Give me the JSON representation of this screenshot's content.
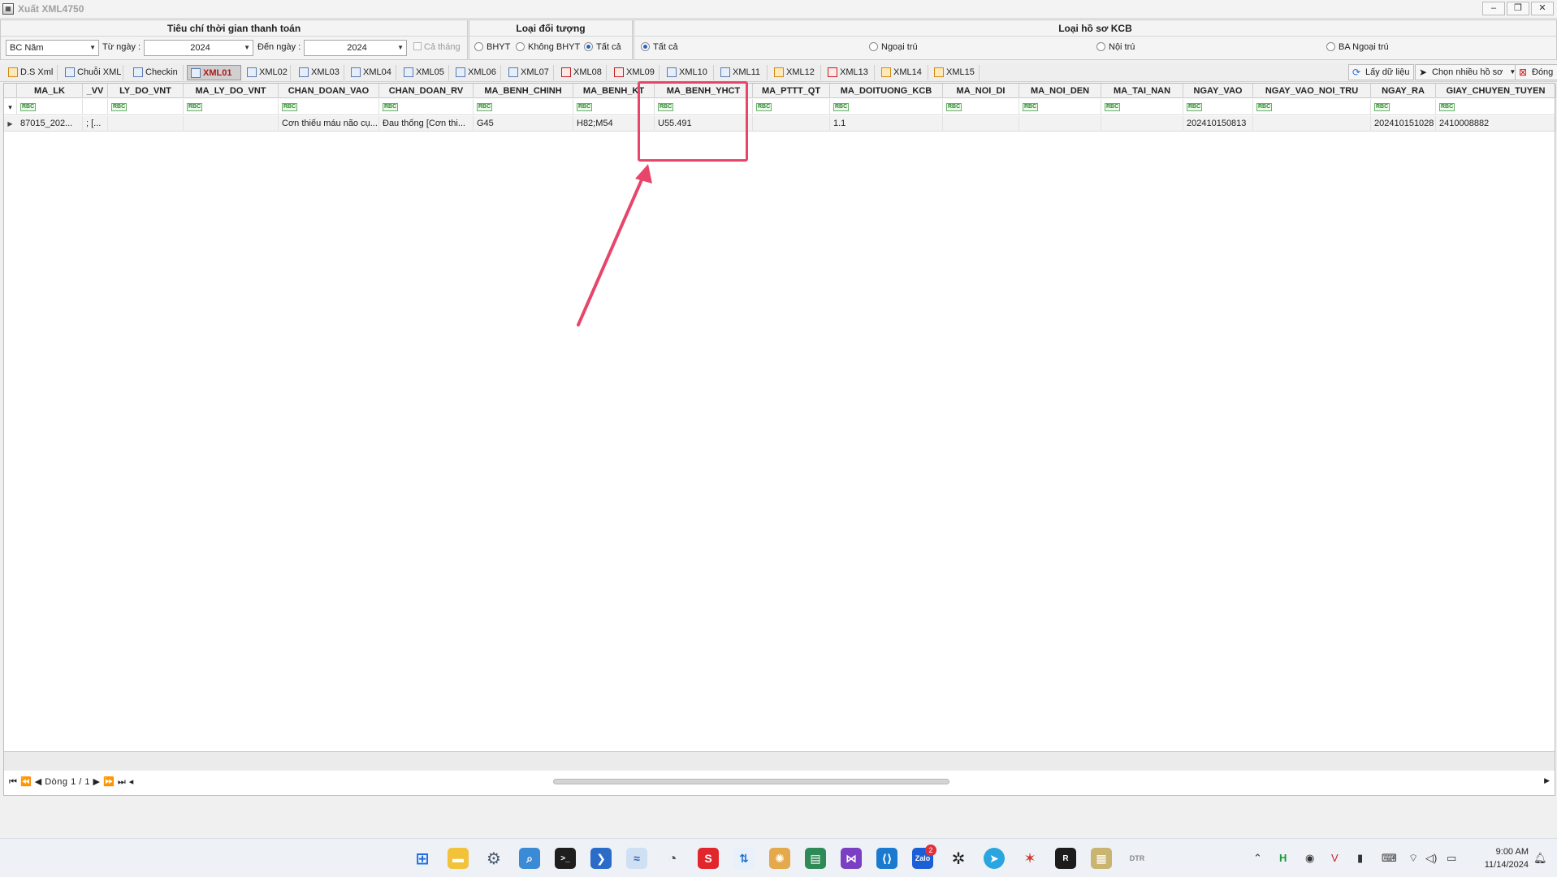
{
  "window": {
    "title": "Xuất XML4750"
  },
  "criteria": {
    "time_group_title": "Tiêu chí thời gian thanh toán",
    "report_type": "BC Năm",
    "from_label": "Từ ngày :",
    "from_value": "2024",
    "to_label": "Đến ngày :",
    "to_value": "2024",
    "whole_month_label": "Cả tháng",
    "subject_group_title": "Loại đối tượng",
    "subject_options": [
      "BHYT",
      "Không BHYT",
      "Tất cả"
    ],
    "subject_selected": "Tất cả",
    "record_group_title": "Loại hồ sơ KCB",
    "record_options": [
      "Tất cả",
      "Ngoại trú",
      "Nội trú",
      "BA Ngoại trú"
    ],
    "record_selected": "Tất cả"
  },
  "tabs": [
    "D.S Xml",
    "Chuỗi XML",
    "Checkin",
    "XML01",
    "XML02",
    "XML03",
    "XML04",
    "XML05",
    "XML06",
    "XML07",
    "XML08",
    "XML09",
    "XML10",
    "XML11",
    "XML12",
    "XML13",
    "XML14",
    "XML15"
  ],
  "active_tab": "XML01",
  "actions": {
    "fetch": "Lấy dữ liệu",
    "choose_multi": "Chọn nhiều hồ sơ",
    "close": "Đóng"
  },
  "grid": {
    "columns": [
      "MA_LK",
      "_VV",
      "LY_DO_VNT",
      "MA_LY_DO_VNT",
      "CHAN_DOAN_VAO",
      "CHAN_DOAN_RV",
      "MA_BENH_CHINH",
      "MA_BENH_KT",
      "MA_BENH_YHCT",
      "MA_PTTT_QT",
      "MA_DOITUONG_KCB",
      "MA_NOI_DI",
      "MA_NOI_DEN",
      "MA_TAI_NAN",
      "NGAY_VAO",
      "NGAY_VAO_NOI_TRU",
      "NGAY_RA",
      "GIAY_CHUYEN_TUYEN"
    ],
    "filter_glyph": "RBC",
    "rows": [
      [
        "87015_202...",
        "; [...",
        "",
        "",
        "Cơn thiếu máu não cụ...",
        "Đau thống [Cơn thi...",
        "G45",
        "H82;M54",
        "U55.491",
        "",
        "1.1",
        "",
        "",
        "",
        "202410150813",
        "",
        "202410151028",
        "2410008882"
      ]
    ],
    "navigator": "Dòng 1 / 1"
  },
  "taskbar": {
    "time": "9:00 AM",
    "date": "11/14/2024",
    "zalo_badge": "2"
  }
}
